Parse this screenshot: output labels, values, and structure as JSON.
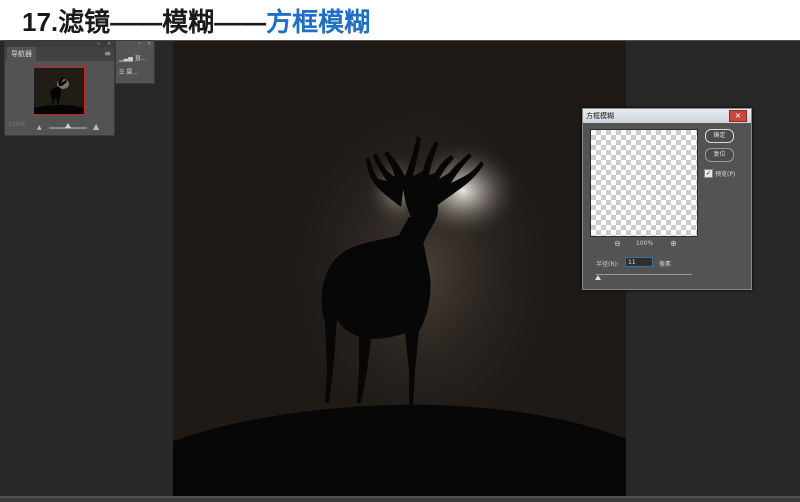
{
  "header": {
    "title_prefix": "17.滤镜——模糊——",
    "title_highlight": "方框模糊"
  },
  "navigator": {
    "tab_label": "导航器",
    "menu_icon": "≡",
    "collapse_icon": "»",
    "close_icon": "×",
    "zoom_text": "100%"
  },
  "mini_panel": {
    "items": [
      "直...",
      "属..."
    ],
    "collapse_icon": "»",
    "close_icon": "×"
  },
  "dialog": {
    "title": "方框模糊",
    "close_icon": "×",
    "ok_label": "确定",
    "reset_label": "复位",
    "preview_label": "预览(P)",
    "preview_checked": "✓",
    "zoom_out_icon": "⊖",
    "zoom_in_icon": "⊕",
    "zoom_level": "100%",
    "radius_label": "半径(R):",
    "radius_value": "11",
    "radius_unit": "像素",
    "radius_slider_fraction": 0.02
  },
  "colors": {
    "title_highlight": "#1f6fc4",
    "canvas_bg": "#1f1a16",
    "workspace": "#535353",
    "dialog_close": "#c8463c"
  }
}
